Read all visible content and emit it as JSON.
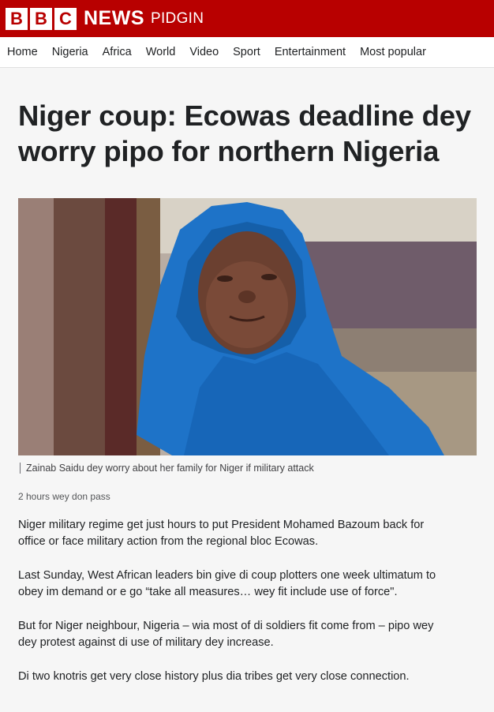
{
  "brand": {
    "letters": [
      "B",
      "B",
      "C"
    ],
    "news": "NEWS",
    "service": "PIDGIN"
  },
  "nav": {
    "items": [
      "Home",
      "Nigeria",
      "Africa",
      "World",
      "Video",
      "Sport",
      "Entertainment",
      "Most popular"
    ]
  },
  "article": {
    "headline": "Niger coup: Ecowas deadline dey worry pipo for northern Nigeria",
    "image_caption": "Zainab Saidu dey worry about her family for Niger if military attack",
    "timestamp": "2 hours wey don pass",
    "paragraphs": [
      "Niger military regime get just hours to put President Mohamed Bazoum back for office or face military action from the regional bloc Ecowas.",
      "Last Sunday, West African leaders bin give di coup plotters one week ultimatum to obey im demand or e go “take all measures… wey fit include use of force\".",
      "But for Niger neighbour, Nigeria – wia most of di soldiers fit come from – pipo wey dey protest against di use of military dey increase.",
      "Di two knotris get very close history plus dia tribes get very close connection."
    ]
  },
  "colors": {
    "brand_red": "#b80000",
    "page_bg": "#f6f6f6",
    "scarf_blue": "#1e73c8"
  }
}
